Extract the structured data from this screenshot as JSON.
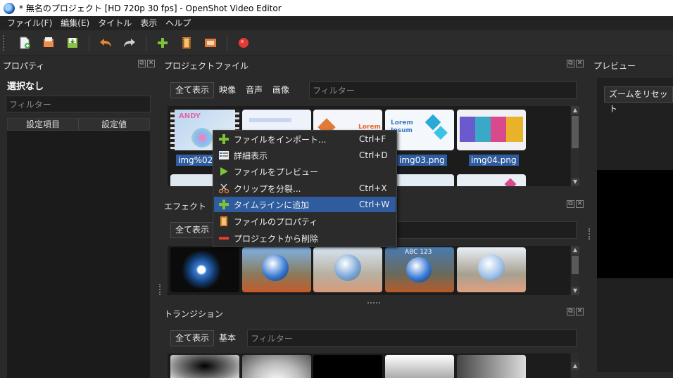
{
  "window": {
    "title": "* 無名のプロジェクト [HD 720p 30 fps] - OpenShot Video Editor"
  },
  "menu": [
    "ファイル(F)",
    "編集(E)",
    "タイトル",
    "表示",
    "ヘルプ"
  ],
  "toolbar": {
    "icons": [
      "new-project-icon",
      "open-project-icon",
      "save-project-icon",
      "undo-icon",
      "redo-icon",
      "import-files-icon",
      "profile-icon",
      "fullscreen-icon",
      "export-video-icon"
    ]
  },
  "properties": {
    "title": "プロパティ",
    "selection": "選択なし",
    "filter_placeholder": "フィルター",
    "col_key": "設定項目",
    "col_value": "設定値"
  },
  "project_files": {
    "title": "プロジェクトファイル",
    "show_all": "全て表示",
    "tabs": [
      "映像",
      "音声",
      "画像"
    ],
    "filter_placeholder": "フィルター",
    "items": [
      {
        "label": "img%02d",
        "thumb_text": "ANDY"
      },
      {
        "label": "",
        "thumb_text": ""
      },
      {
        "label": "",
        "thumb_text": "Lorem"
      },
      {
        "label": "img03.png",
        "thumb_text": "Lorem Ipsum"
      },
      {
        "label": "img04.png",
        "thumb_text": ""
      }
    ]
  },
  "effects": {
    "title": "エフェクト",
    "show_all": "全て表示",
    "thumb_caption": "ABC 123"
  },
  "transitions": {
    "title": "トランジション",
    "show_all": "全て表示",
    "tab_basic": "基本",
    "filter_placeholder": "フィルター"
  },
  "preview": {
    "title": "プレビュー",
    "reset_zoom": "ズームをリセット"
  },
  "context_menu": [
    {
      "label": "ファイルをインポート...",
      "shortcut": "Ctrl+F",
      "icon": "plus-icon"
    },
    {
      "label": "詳細表示",
      "shortcut": "Ctrl+D",
      "icon": "details-icon"
    },
    {
      "label": "ファイルをプレビュー",
      "shortcut": "",
      "icon": "play-icon"
    },
    {
      "label": "クリップを分裂...",
      "shortcut": "Ctrl+X",
      "icon": "scissors-icon"
    },
    {
      "label": "タイムラインに追加",
      "shortcut": "Ctrl+W",
      "icon": "plus-icon",
      "highlighted": true
    },
    {
      "label": "ファイルのプロパティ",
      "shortcut": "",
      "icon": "film-icon"
    },
    {
      "label": "プロジェクトから削除",
      "shortcut": "",
      "icon": "remove-icon"
    }
  ],
  "colors": {
    "highlight": "#2f5c9f",
    "panel": "#2a2a2a",
    "dark": "#1c1c1c"
  }
}
